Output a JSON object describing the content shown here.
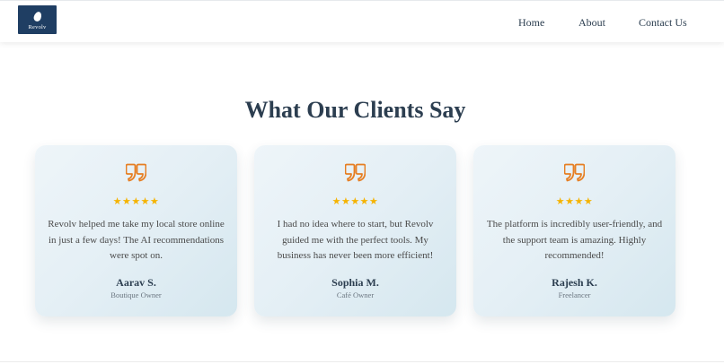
{
  "brand": {
    "logo_text": "Revolv"
  },
  "nav": {
    "home": "Home",
    "about": "About",
    "contact": "Contact Us"
  },
  "section": {
    "title": "What Our Clients Say"
  },
  "colors": {
    "accent": "#e67e22",
    "star": "#f5b301",
    "brand": "#1f3e63"
  },
  "testimonials": [
    {
      "stars": "★★★★★",
      "rating": 5,
      "quote": "Revolv helped me take my local store online in just a few days! The AI recommendations were spot on.",
      "name": "Aarav S.",
      "role": "Boutique Owner"
    },
    {
      "stars": "★★★★★",
      "rating": 5,
      "quote": "I had no idea where to start, but Revolv guided me with the perfect tools. My business has never been more efficient!",
      "name": "Sophia M.",
      "role": "Café Owner"
    },
    {
      "stars": "★★★★",
      "rating": 4,
      "quote": "The platform is incredibly user-friendly, and the support team is amazing. Highly recommended!",
      "name": "Rajesh K.",
      "role": "Freelancer"
    }
  ]
}
